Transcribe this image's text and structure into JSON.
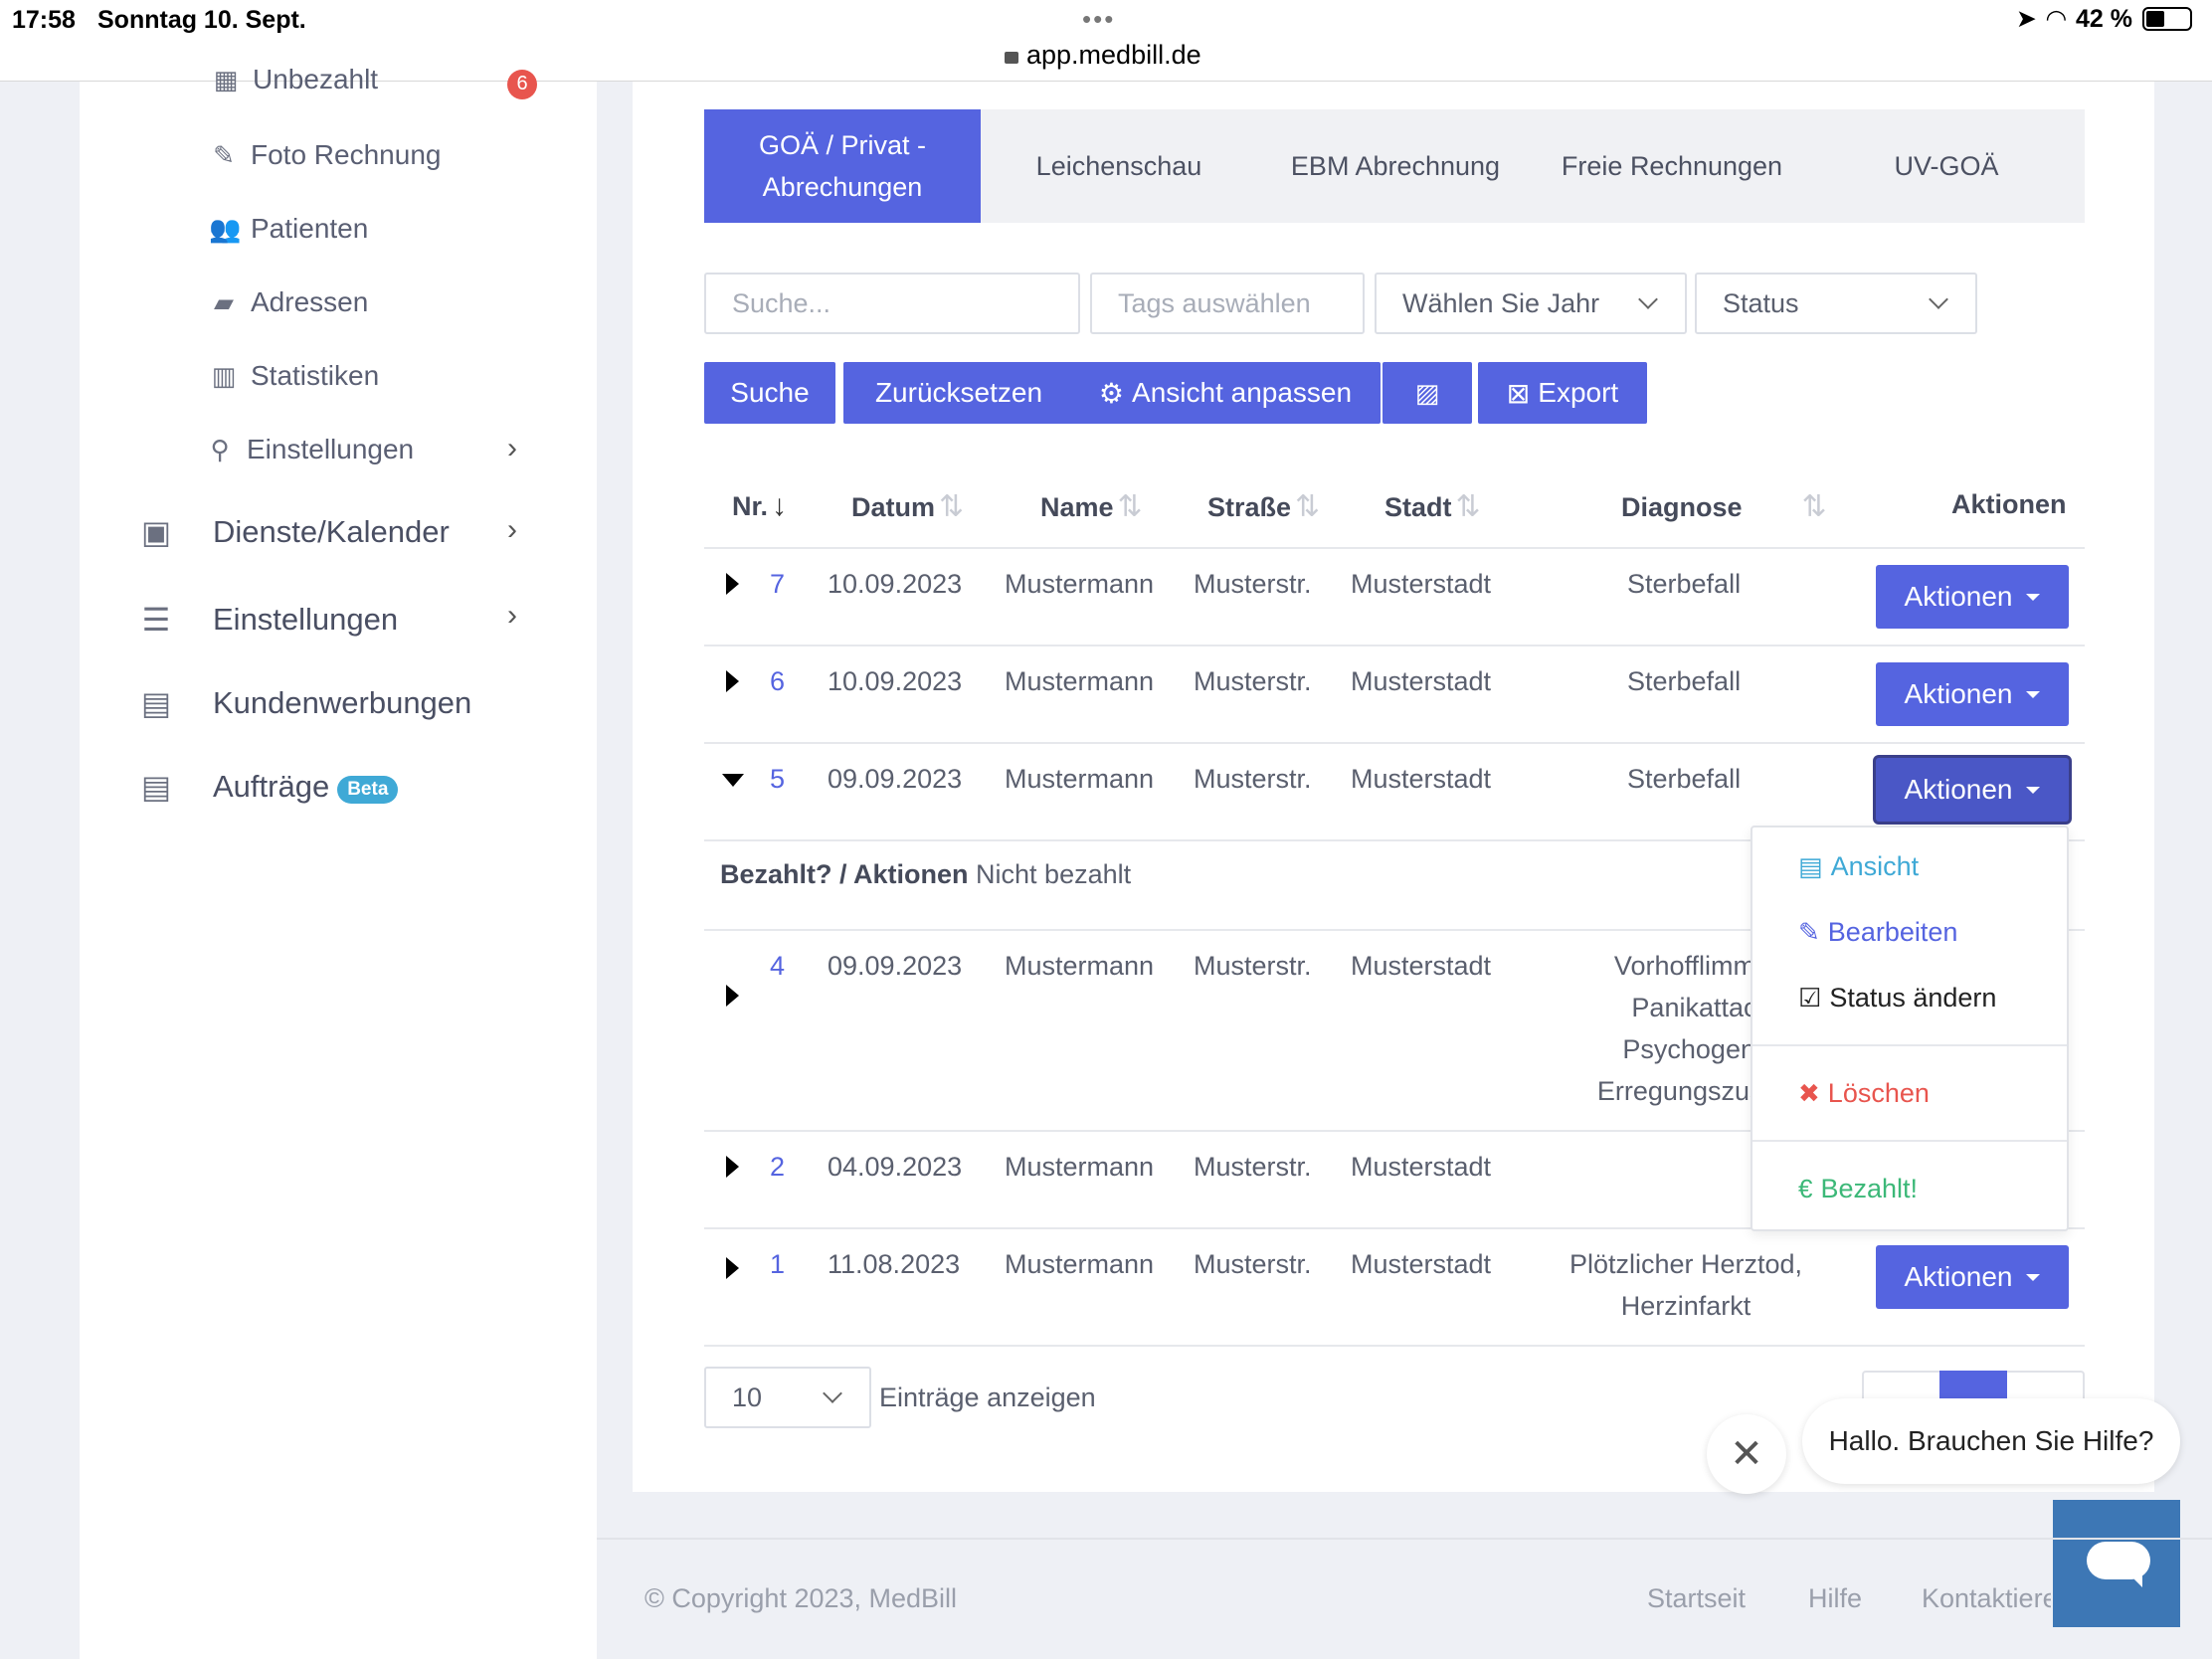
{
  "statusbar": {
    "time": "17:58",
    "date": "Sonntag 10. Sept.",
    "battery": "42 %",
    "url": "app.medbill.de",
    "dots": "•••"
  },
  "sidebar": {
    "unpaid": {
      "label": "Unbezahlt",
      "badge": "6"
    },
    "items": [
      {
        "label": "Foto Rechnung",
        "icon": "edit-icon"
      },
      {
        "label": "Patienten",
        "icon": "users-icon"
      },
      {
        "label": "Adressen",
        "icon": "book-icon"
      },
      {
        "label": "Statistiken",
        "icon": "bar-chart-icon"
      },
      {
        "label": "Einstellungen",
        "icon": "wrench-icon"
      }
    ],
    "main": [
      {
        "label": "Dienste/Kalender",
        "icon": "calendar-icon"
      },
      {
        "label": "Einstellungen",
        "icon": "list-icon"
      },
      {
        "label": "Kundenwerbungen",
        "icon": "document-icon"
      },
      {
        "label": "Aufträge",
        "icon": "document-icon",
        "badge": "Beta"
      }
    ]
  },
  "tabs": [
    "GOÄ / Privat - Abrechungen",
    "Leichenschau",
    "EBM Abrechnung",
    "Freie Rechnungen",
    "UV-GOÄ"
  ],
  "filters": {
    "search_placeholder": "Suche...",
    "tags": "Tags auswählen",
    "year": "Wählen Sie Jahr",
    "status": "Status"
  },
  "buttons": {
    "search": "Suche",
    "reset": "Zurücksetzen",
    "customize": "Ansicht anpassen",
    "export": "Export"
  },
  "table": {
    "headers": {
      "nr": "Nr.",
      "date": "Datum",
      "name": "Name",
      "street": "Straße",
      "city": "Stadt",
      "diagnosis": "Diagnose",
      "actions": "Aktionen"
    },
    "rows": [
      {
        "nr": "7",
        "date": "10.09.2023",
        "name": "Mustermann",
        "street": "Musterstr.",
        "city": "Musterstadt",
        "diagnosis": "Sterbefall",
        "action": "Aktionen"
      },
      {
        "nr": "6",
        "date": "10.09.2023",
        "name": "Mustermann",
        "street": "Musterstr.",
        "city": "Musterstadt",
        "diagnosis": "Sterbefall",
        "action": "Aktionen"
      },
      {
        "nr": "5",
        "date": "09.09.2023",
        "name": "Mustermann",
        "street": "Musterstr.",
        "city": "Musterstadt",
        "diagnosis": "Sterbefall",
        "action": "Aktionen"
      },
      {
        "nr": "4",
        "date": "09.09.2023",
        "name": "Mustermann",
        "street": "Musterstr.",
        "city": "Musterstadt",
        "diagnosis": [
          "Vorhofflimme",
          "Panikattack",
          "Psychogene",
          "Erregungszust"
        ]
      },
      {
        "nr": "2",
        "date": "04.09.2023",
        "name": "Mustermann",
        "street": "Musterstr.",
        "city": "Musterstadt",
        "diagnosis": ""
      },
      {
        "nr": "1",
        "date": "11.08.2023",
        "name": "Mustermann",
        "street": "Musterstr.",
        "city": "Musterstadt",
        "diagnosis": [
          "Plötzlicher Herztod,",
          "Herzinfarkt"
        ],
        "action": "Aktionen"
      }
    ],
    "expanded": {
      "label": "Bezahlt? / Aktionen",
      "value": "Nicht bezahlt"
    }
  },
  "dropdown": {
    "view": "Ansicht",
    "edit": "Bearbeiten",
    "status": "Status ändern",
    "delete": "Löschen",
    "paid": "Bezahlt!"
  },
  "pagination": {
    "per_page": "10",
    "label": "Einträge anzeigen"
  },
  "chat": {
    "message": "Hallo. Brauchen Sie Hilfe?"
  },
  "footer": {
    "copyright": "© Copyright 2023, MedBill",
    "links": [
      "Startseit",
      "Hilfe",
      "Kontaktiere"
    ]
  },
  "colors": {
    "primary": "#5564e0",
    "danger": "#e8554e",
    "success": "#3cb878",
    "info": "#3fa9d6",
    "chat": "#3d77b5"
  }
}
